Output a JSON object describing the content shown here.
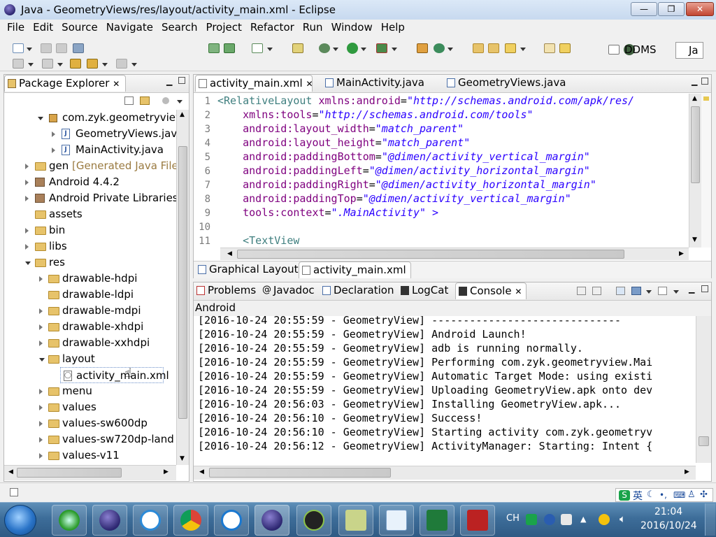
{
  "window": {
    "title": "Java - GeometryViews/res/layout/activity_main.xml - Eclipse"
  },
  "menu": [
    "File",
    "Edit",
    "Source",
    "Navigate",
    "Search",
    "Project",
    "Refactor",
    "Run",
    "Window",
    "Help"
  ],
  "toolbar": {
    "perspective_ddms": "DDMS",
    "perspective_java": "Ja"
  },
  "package_explorer": {
    "title": "Package Explorer",
    "rows": [
      {
        "label": "com.zyk.geometryview",
        "suffix": ""
      },
      {
        "label": "GeometryViews.java",
        "suffix": ""
      },
      {
        "label": "MainActivity.java",
        "suffix": ""
      },
      {
        "label": "gen",
        "suffix": "[Generated Java Files]"
      },
      {
        "label": "Android 4.4.2",
        "suffix": ""
      },
      {
        "label": "Android Private Libraries",
        "suffix": ""
      },
      {
        "label": "assets",
        "suffix": ""
      },
      {
        "label": "bin",
        "suffix": ""
      },
      {
        "label": "libs",
        "suffix": ""
      },
      {
        "label": "res",
        "suffix": ""
      },
      {
        "label": "drawable-hdpi",
        "suffix": ""
      },
      {
        "label": "drawable-ldpi",
        "suffix": ""
      },
      {
        "label": "drawable-mdpi",
        "suffix": ""
      },
      {
        "label": "drawable-xhdpi",
        "suffix": ""
      },
      {
        "label": "drawable-xxhdpi",
        "suffix": ""
      },
      {
        "label": "layout",
        "suffix": ""
      },
      {
        "label": "activity_main.xml",
        "suffix": ""
      },
      {
        "label": "menu",
        "suffix": ""
      },
      {
        "label": "values",
        "suffix": ""
      },
      {
        "label": "values-sw600dp",
        "suffix": ""
      },
      {
        "label": "values-sw720dp-land",
        "suffix": ""
      },
      {
        "label": "values-v11",
        "suffix": ""
      }
    ]
  },
  "editor": {
    "tabs": [
      "activity_main.xml",
      "MainActivity.java",
      "GeometryViews.java"
    ],
    "lines": [
      {
        "num": "1",
        "indent": "",
        "tag": "<RelativeLayout",
        "attr": " xmlns:android",
        "val": "\"http://schemas.android.com/apk/res/"
      },
      {
        "num": "2",
        "indent": "    ",
        "tag": "",
        "attr": "xmlns:tools",
        "val": "\"http://schemas.android.com/tools\""
      },
      {
        "num": "3",
        "indent": "    ",
        "tag": "",
        "attr": "android:layout_width",
        "val": "\"match_parent\""
      },
      {
        "num": "4",
        "indent": "    ",
        "tag": "",
        "attr": "android:layout_height",
        "val": "\"match_parent\""
      },
      {
        "num": "5",
        "indent": "    ",
        "tag": "",
        "attr": "android:paddingBottom",
        "val": "\"@dimen/activity_vertical_margin\""
      },
      {
        "num": "6",
        "indent": "    ",
        "tag": "",
        "attr": "android:paddingLeft",
        "val": "\"@dimen/activity_horizontal_margin\""
      },
      {
        "num": "7",
        "indent": "    ",
        "tag": "",
        "attr": "android:paddingRight",
        "val": "\"@dimen/activity_horizontal_margin\""
      },
      {
        "num": "8",
        "indent": "    ",
        "tag": "",
        "attr": "android:paddingTop",
        "val": "\"@dimen/activity_vertical_margin\""
      },
      {
        "num": "9",
        "indent": "    ",
        "tag": "",
        "attr": "tools:context",
        "val": "\".MainActivity\" >"
      },
      {
        "num": "10",
        "indent": "",
        "tag": "",
        "attr": "",
        "val": ""
      },
      {
        "num": "11",
        "indent": "    ",
        "tag": "<TextView",
        "attr": "",
        "val": ""
      }
    ],
    "bottom_tabs": [
      "Graphical Layout",
      "activity_main.xml"
    ]
  },
  "console": {
    "tabs": [
      "Problems",
      "Javadoc",
      "Declaration",
      "LogCat",
      "Console"
    ],
    "header": "Android",
    "lines": [
      "[2016-10-24 20:55:59 - GeometryView] ------------------------------",
      "[2016-10-24 20:55:59 - GeometryView] Android Launch!",
      "[2016-10-24 20:55:59 - GeometryView] adb is running normally.",
      "[2016-10-24 20:55:59 - GeometryView] Performing com.zyk.geometryview.Mai",
      "[2016-10-24 20:55:59 - GeometryView] Automatic Target Mode: using existi",
      "[2016-10-24 20:55:59 - GeometryView] Uploading GeometryView.apk onto dev",
      "[2016-10-24 20:56:03 - GeometryView] Installing GeometryView.apk...",
      "[2016-10-24 20:56:10 - GeometryView] Success!",
      "[2016-10-24 20:56:10 - GeometryView] Starting activity com.zyk.geometryv",
      "[2016-10-24 20:56:12 - GeometryView] ActivityManager: Starting: Intent {"
    ]
  },
  "taskbar": {
    "time": "21:04",
    "date": "2016/10/24",
    "lang": "CH",
    "ime": "英"
  },
  "colors": {
    "title_bg": "#c7d9ef",
    "taskbar": "#3d6d99",
    "xml_tag": "#3f7f7f",
    "xml_attr": "#7f007f",
    "xml_value": "#2a00ff"
  }
}
